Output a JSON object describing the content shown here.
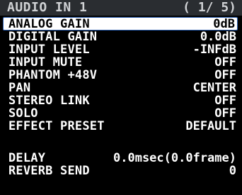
{
  "header": {
    "title": "AUDIO IN 1",
    "page": "( 1/ 5)"
  },
  "items": [
    {
      "label": "ANALOG GAIN",
      "value": "0dB",
      "selected": true
    },
    {
      "label": "DIGITAL GAIN",
      "value": "0.0dB"
    },
    {
      "label": "INPUT LEVEL",
      "value": "-INFdB"
    },
    {
      "label": "INPUT MUTE",
      "value": "OFF"
    },
    {
      "label": "PHANTOM +48V",
      "value": "OFF"
    },
    {
      "label": "PAN",
      "value": "CENTER"
    },
    {
      "label": "STEREO LINK",
      "value": "OFF"
    },
    {
      "label": "SOLO",
      "value": "OFF"
    },
    {
      "label": "EFFECT PRESET",
      "value": "DEFAULT"
    },
    {
      "label": "DELAY",
      "value": "0.0msec(0.0frame)"
    },
    {
      "label": "REVERB SEND",
      "value": "0"
    }
  ]
}
